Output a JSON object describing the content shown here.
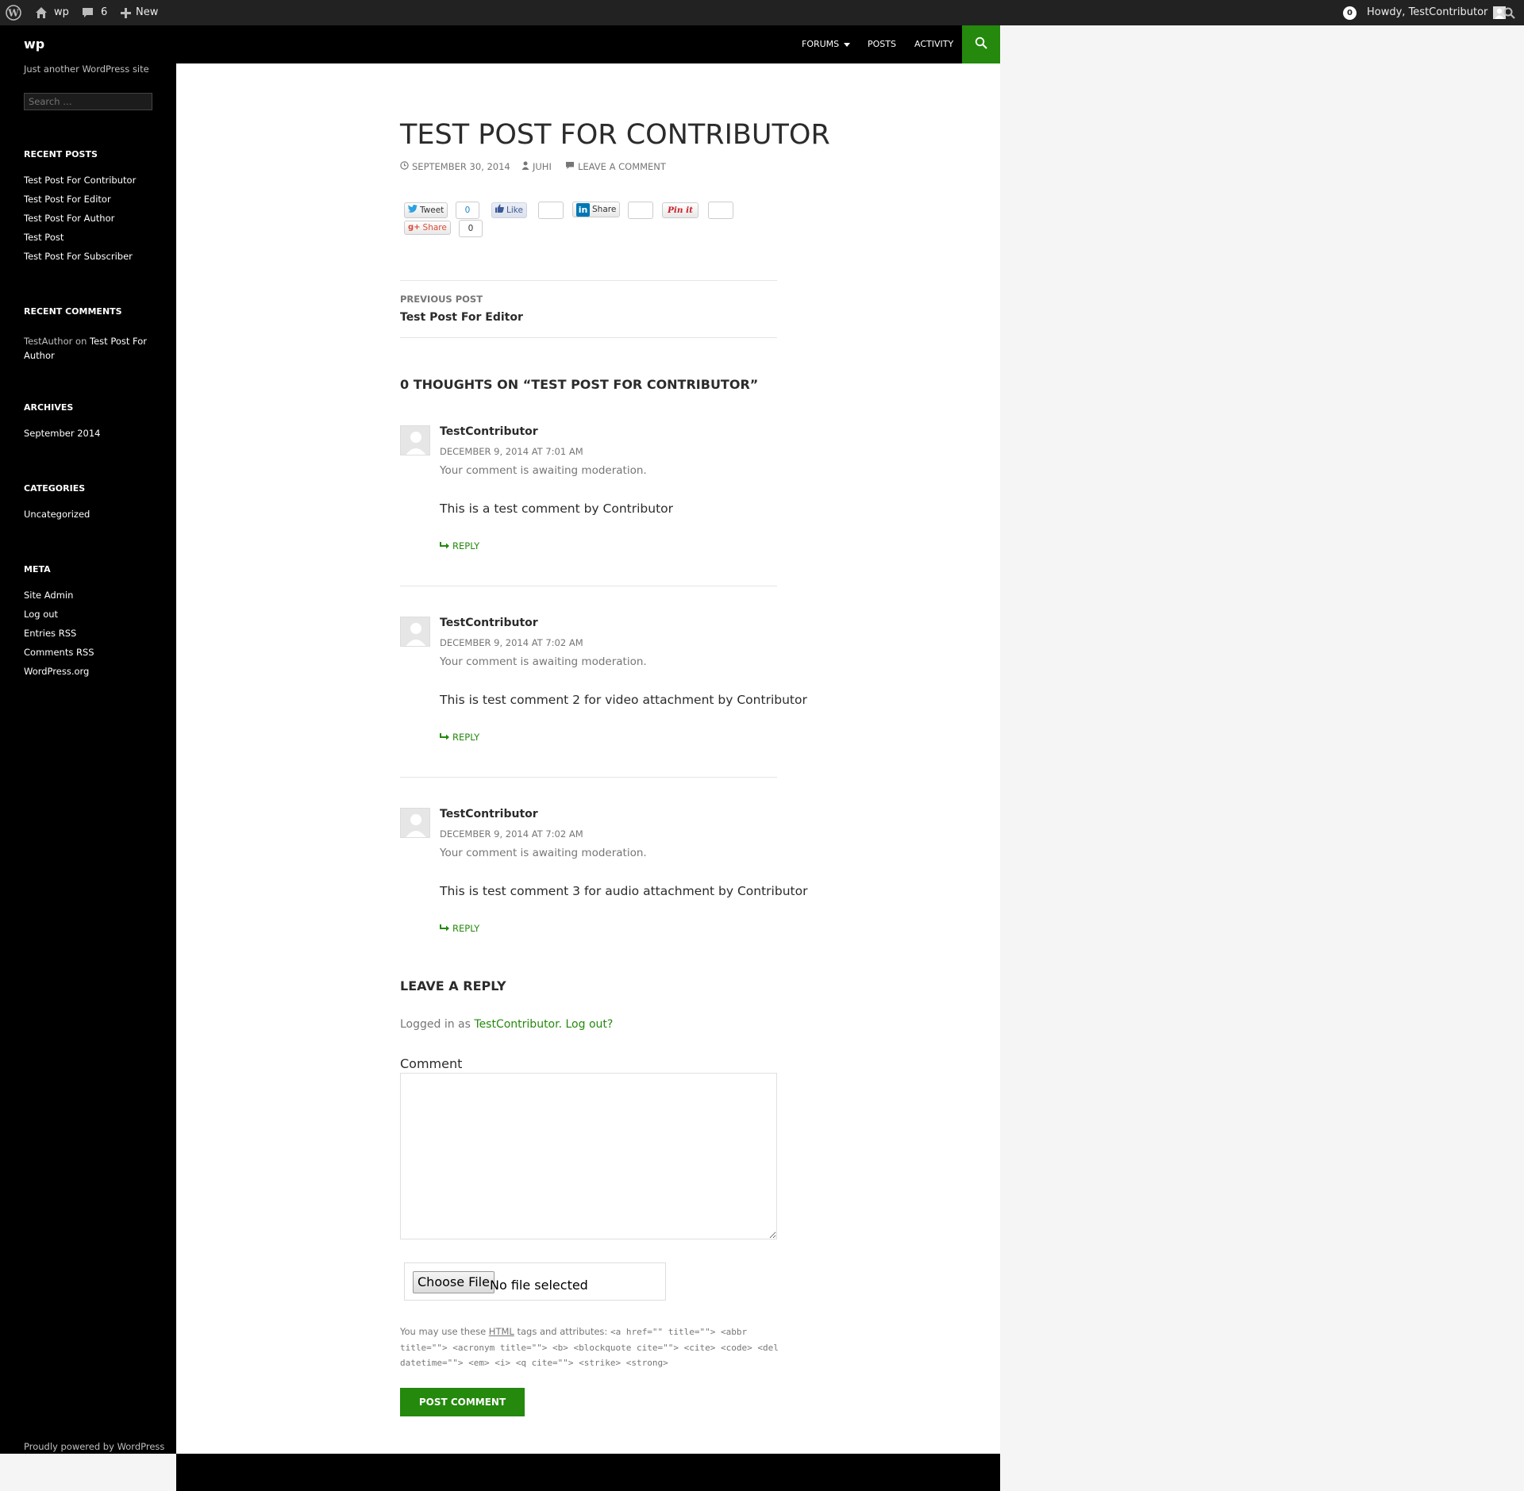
{
  "admin_bar": {
    "site_name": "wp",
    "comments_count": "6",
    "new_label": "New",
    "notifications": "0",
    "howdy": "Howdy, TestContributor"
  },
  "site": {
    "title": "wp",
    "description": "Just another WordPress site",
    "search_placeholder": "Search …"
  },
  "widgets": {
    "recent_posts": {
      "title": "Recent Posts",
      "items": [
        "Test Post For Contributor",
        "Test Post For Editor",
        "Test Post For Author",
        "Test Post",
        "Test Post For Subscriber"
      ]
    },
    "recent_comments": {
      "title": "Recent Comments",
      "author": "TestAuthor",
      "on": "on",
      "post": "Test Post For Author"
    },
    "archives": {
      "title": "Archives",
      "items": [
        "September 2014"
      ]
    },
    "categories": {
      "title": "Categories",
      "items": [
        "Uncategorized"
      ]
    },
    "meta": {
      "title": "Meta",
      "items": [
        "Site Admin",
        "Log out",
        "Entries RSS",
        "Comments RSS",
        "WordPress.org"
      ]
    }
  },
  "nav": {
    "items": [
      "Forums",
      "Posts",
      "Activity"
    ]
  },
  "post": {
    "title": "Test Post For Contributor",
    "date": "September 30, 2014",
    "author": "Juhi",
    "leave_comment": "Leave a comment"
  },
  "share": {
    "tweet": "Tweet",
    "tweet_count": "0",
    "like": "Like",
    "linkedin": "Share",
    "pinit": "Pin it",
    "gplus": "Share",
    "gplus_count": "0"
  },
  "post_nav": {
    "label": "Previous Post",
    "title": "Test Post For Editor"
  },
  "comments": {
    "heading": "0 thoughts on “Test Post For Contributor”",
    "items": [
      {
        "author": "TestContributor",
        "date": "December 9, 2014 at 7:01 am",
        "moderation": "Your comment is awaiting moderation.",
        "text": "This is a test comment by Contributor",
        "reply": "Reply"
      },
      {
        "author": "TestContributor",
        "date": "December 9, 2014 at 7:02 am",
        "moderation": "Your comment is awaiting moderation.",
        "text": "This is test comment 2 for video attachment by Contributor",
        "reply": "Reply"
      },
      {
        "author": "TestContributor",
        "date": "December 9, 2014 at 7:02 am",
        "moderation": "Your comment is awaiting moderation.",
        "text": "This is test comment 3 for audio attachment by Contributor",
        "reply": "Reply"
      }
    ]
  },
  "reply_form": {
    "title": "Leave a Reply",
    "logged_in_prefix": "Logged in as",
    "user": "TestContributor",
    "logout": "Log out?",
    "comment_label": "Comment",
    "choose_file": "Choose File",
    "no_file": "No file selected",
    "allowed_prefix": "You may use these",
    "allowed_html": "HTML",
    "allowed_suffix": "tags and attributes:",
    "allowed_tags": "<a href=\"\" title=\"\"> <abbr title=\"\"> <acronym title=\"\"> <b> <blockquote cite=\"\"> <cite> <code> <del datetime=\"\"> <em> <i> <q cite=\"\"> <strike> <strong>",
    "submit": "Post Comment"
  },
  "footer": {
    "text": "Proudly powered by WordPress"
  },
  "colors": {
    "accent": "#24890d",
    "header_bg": "#000000",
    "admin_bar_bg": "#222222"
  }
}
